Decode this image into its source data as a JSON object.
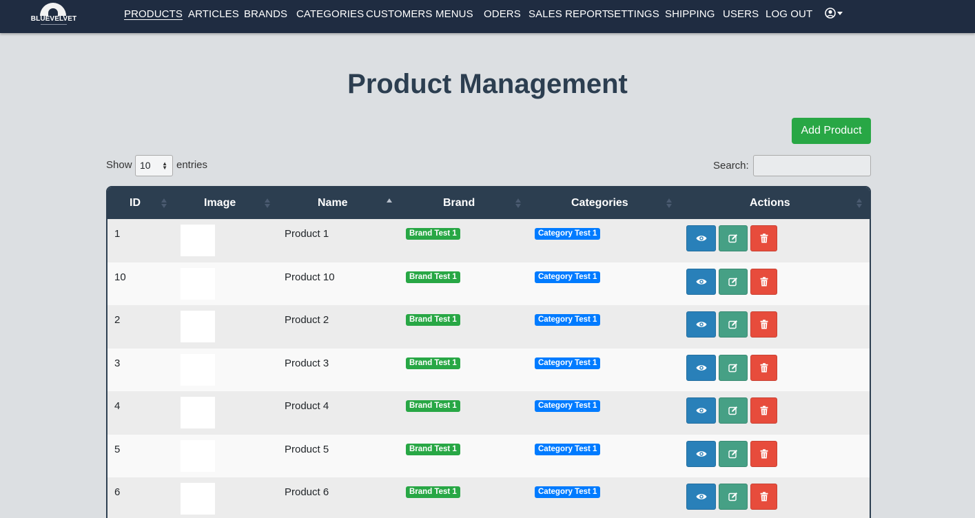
{
  "brand": {
    "logo_text": "BLUEVELVET",
    "logo_icon": "vinyl-record-logo"
  },
  "nav": {
    "items": [
      {
        "label": "PRODUCTS",
        "active": true
      },
      {
        "label": "ARTICLES"
      },
      {
        "label": "BRANDS"
      },
      {
        "label": "CATEGORIES"
      },
      {
        "label": "CUSTOMERS"
      },
      {
        "label": "MENUS"
      },
      {
        "label": "ODERS"
      },
      {
        "label": "SALES REPORT"
      },
      {
        "label": "SETTINGS"
      },
      {
        "label": "SHIPPING"
      },
      {
        "label": "USERS"
      },
      {
        "label": "LOG OUT"
      }
    ],
    "user_icon": "user-circle-icon"
  },
  "page": {
    "title": "Product Management",
    "add_button": "Add Product"
  },
  "controls": {
    "show_label": "Show",
    "entries_value": "10",
    "entries_label": "entries",
    "search_label": "Search:",
    "search_value": ""
  },
  "table": {
    "columns": [
      "ID",
      "Image",
      "Name",
      "Brand",
      "Categories",
      "Actions"
    ],
    "sorted_column": "Name",
    "rows": [
      {
        "id": "1",
        "name": "Product 1",
        "brand": "Brand Test 1",
        "category": "Category Test 1"
      },
      {
        "id": "10",
        "name": "Product 10",
        "brand": "Brand Test 1",
        "category": "Category Test 1"
      },
      {
        "id": "2",
        "name": "Product 2",
        "brand": "Brand Test 1",
        "category": "Category Test 1"
      },
      {
        "id": "3",
        "name": "Product 3",
        "brand": "Brand Test 1",
        "category": "Category Test 1"
      },
      {
        "id": "4",
        "name": "Product 4",
        "brand": "Brand Test 1",
        "category": "Category Test 1"
      },
      {
        "id": "5",
        "name": "Product 5",
        "brand": "Brand Test 1",
        "category": "Category Test 1"
      },
      {
        "id": "6",
        "name": "Product 6",
        "brand": "Brand Test 1",
        "category": "Category Test 1"
      }
    ],
    "action_icons": [
      "eye-icon",
      "edit-icon",
      "trash-icon"
    ]
  },
  "colors": {
    "navbar": "#1f2c41",
    "header": "#2c3e50",
    "add_button": "#28a745",
    "brand_badge": "#28a745",
    "category_badge": "#007bff",
    "view_button": "#2980b9",
    "edit_button": "#46a085",
    "delete_button": "#e74c3c"
  }
}
